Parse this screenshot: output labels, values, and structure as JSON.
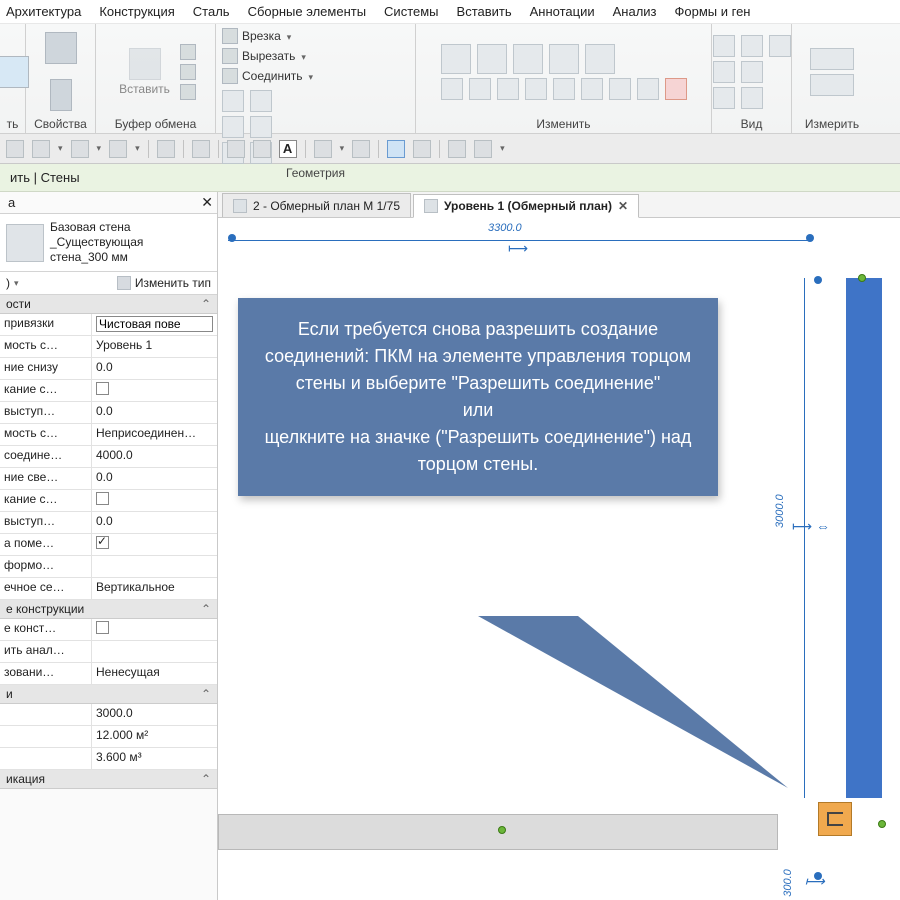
{
  "menu": [
    "Архитектура",
    "Конструкция",
    "Сталь",
    "Сборные элементы",
    "Системы",
    "Вставить",
    "Аннотации",
    "Анализ",
    "Формы и ген"
  ],
  "ribbon": {
    "g0_label": "ть",
    "g1_label": "Свойства",
    "g2_label": "Буфер обмена",
    "g2_paste": "Вставить",
    "geom_label": "Геометрия",
    "geom_cut": "Врезка",
    "geom_slice": "Вырезать",
    "geom_join": "Соединить",
    "mod_label": "Изменить",
    "view_label": "Вид",
    "meas_label": "Измерить"
  },
  "infobar": "ить | Стены",
  "panel": {
    "title": "а",
    "type_l1": "Базовая стена",
    "type_l2": "_Существующая",
    "type_l3": "стена_300 мм",
    "count_suffix": ")",
    "edit_type": "Изменить тип",
    "cat_constraints": "ости",
    "cat_structure": "е конструкции",
    "cat_dims_suffix": "и",
    "cat_id": "икация",
    "rows": [
      {
        "n": "привязки",
        "v_input": "Чистовая пове"
      },
      {
        "n": "мость с…",
        "v": "Уровень 1"
      },
      {
        "n": "ние снизу",
        "v": "0.0"
      },
      {
        "n": "кание с…",
        "chk": false
      },
      {
        "n": "выступ…",
        "v": "0.0"
      },
      {
        "n": "мость с…",
        "v": "Неприсоединен…"
      },
      {
        "n": "соедине…",
        "v": "4000.0"
      },
      {
        "n": "ние све…",
        "v": "0.0"
      },
      {
        "n": "кание с…",
        "chk": false
      },
      {
        "n": "выступ…",
        "v": "0.0"
      },
      {
        "n": "а поме…",
        "chk": true
      },
      {
        "n": "формо…",
        "v": ""
      },
      {
        "n": "ечное се…",
        "v": "Вертикальное"
      }
    ],
    "struct_rows": [
      {
        "n": "е конст…",
        "chk": false
      },
      {
        "n": "ить анал…",
        "v": ""
      },
      {
        "n": "зовани…",
        "v": "Ненесущая"
      }
    ],
    "dim_rows": [
      {
        "n": "",
        "v": "3000.0"
      },
      {
        "n": "",
        "v": "12.000 м²"
      },
      {
        "n": "",
        "v": "3.600 м³"
      }
    ]
  },
  "tabs": [
    {
      "label": "2 - Обмерный план М 1/75",
      "active": false
    },
    {
      "label": "Уровень 1 (Обмерный план)",
      "active": true
    }
  ],
  "canvas": {
    "dim_top": "3300.0",
    "dim_right": "3000.0",
    "dim_bottom": "300.0"
  },
  "callout": {
    "l1": "Если требуется снова разрешить создание соединений: ПКМ на элементе управления торцом стены и выберите \"Разрешить соединение\"",
    "l2": "или",
    "l3": "щелкните на значке (\"Разрешить соединение\") над торцом стены."
  }
}
